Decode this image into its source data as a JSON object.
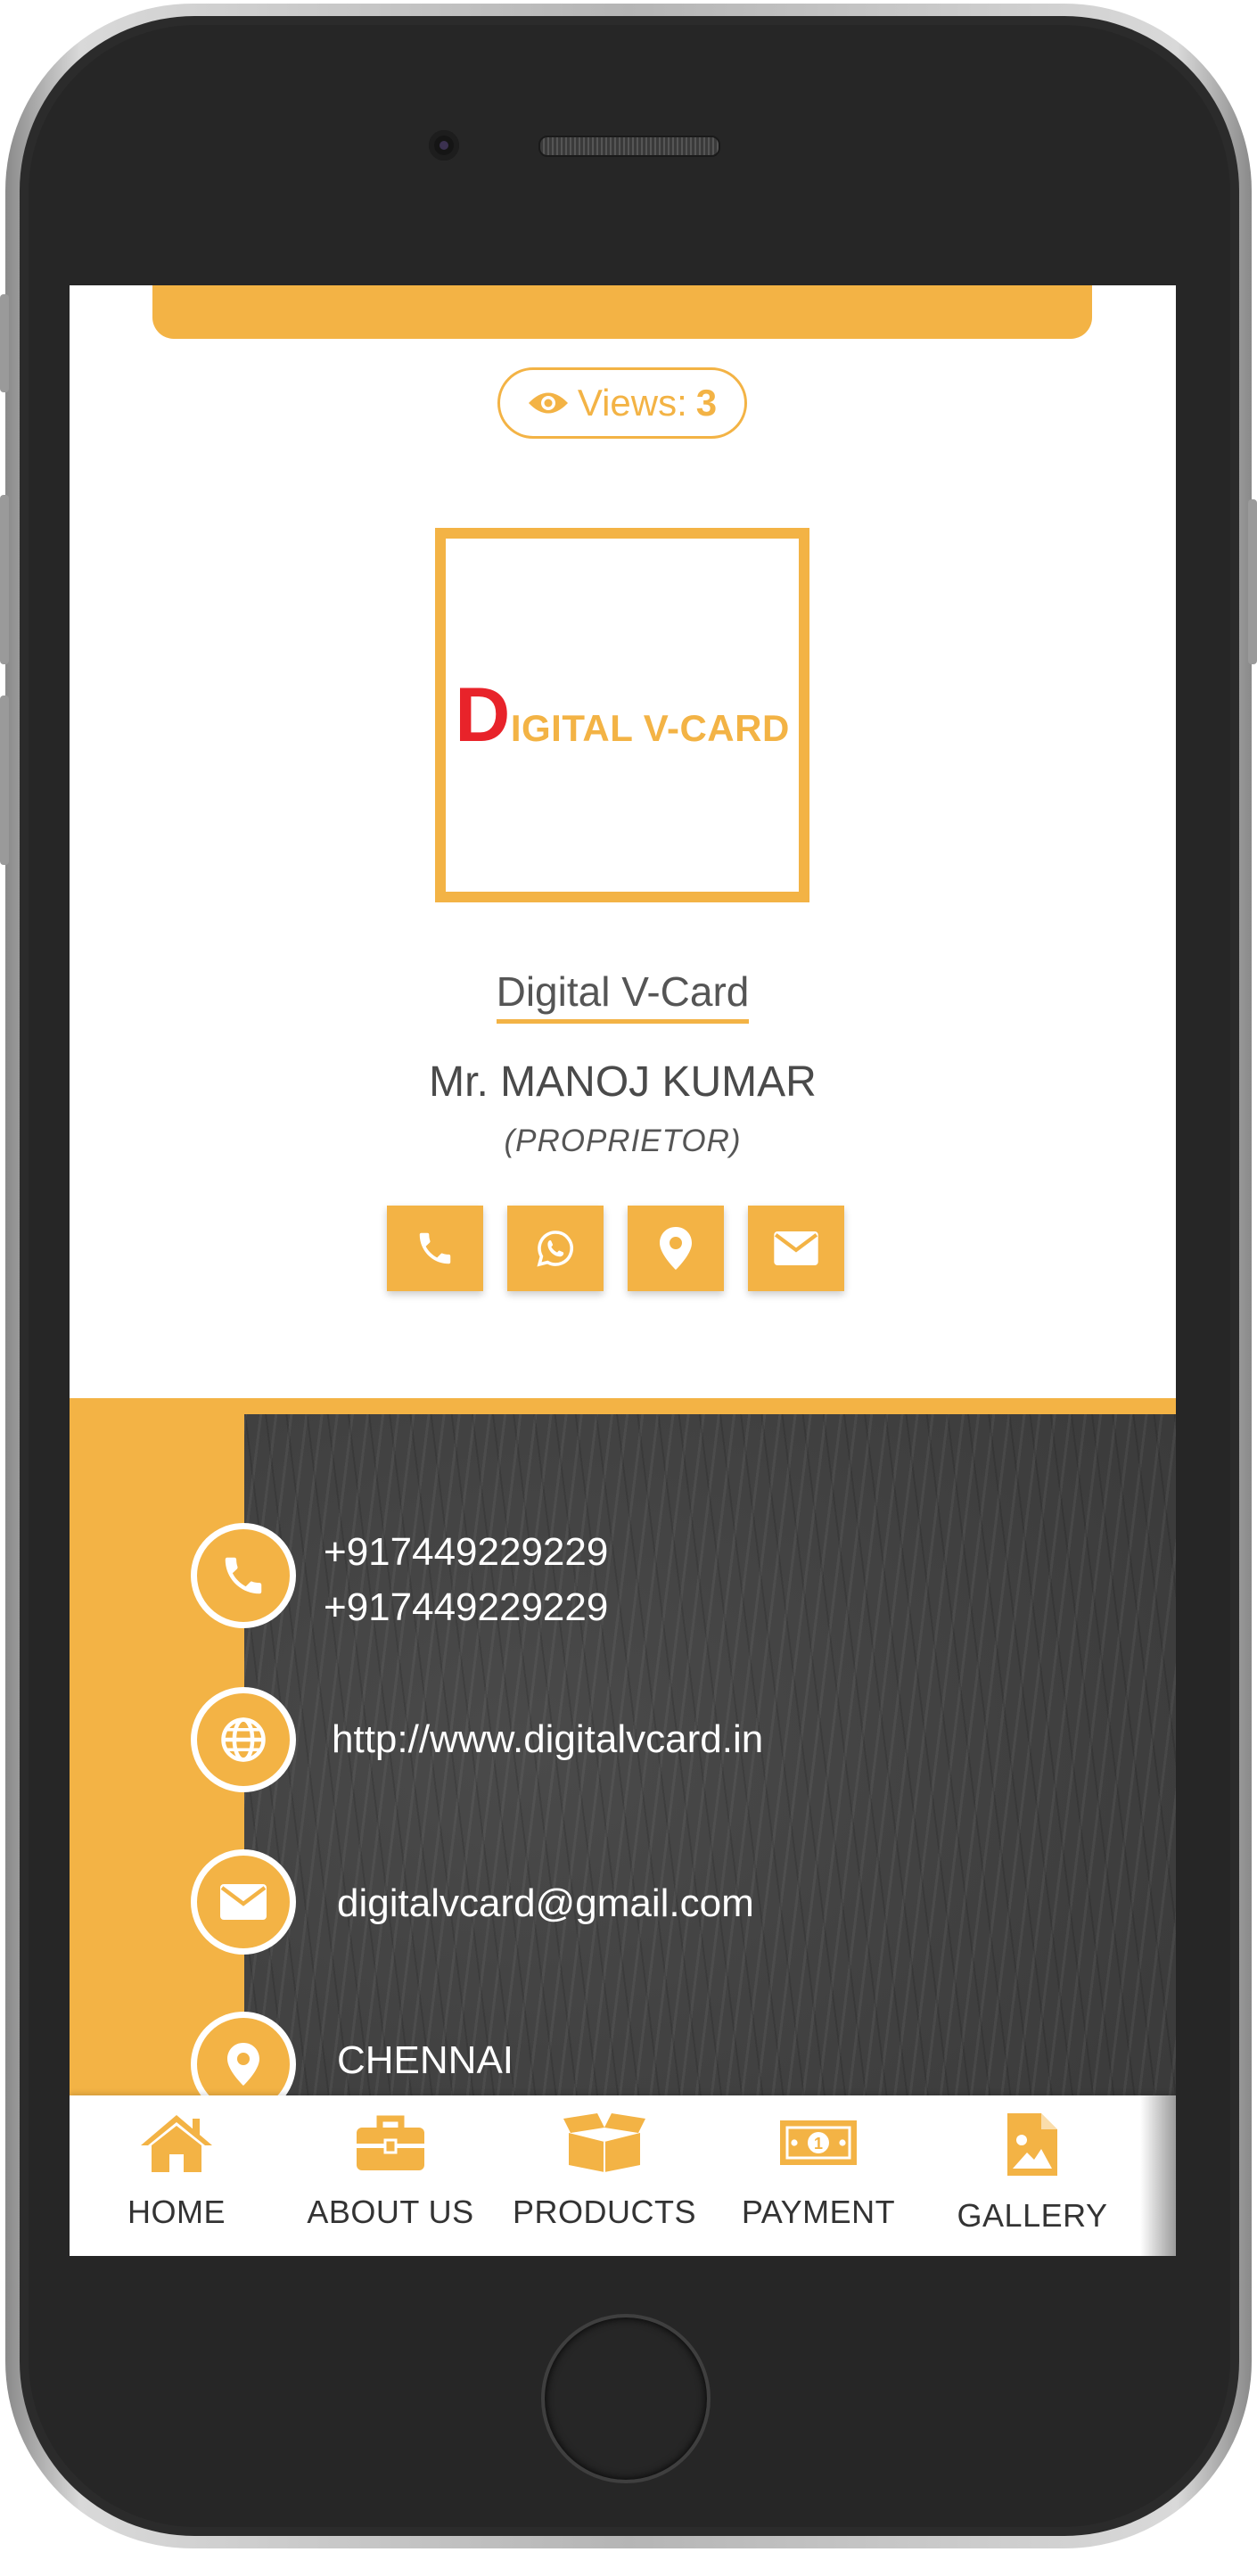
{
  "colors": {
    "accent": "#f3b345",
    "logo_red": "#e8232a",
    "dark_bg": "#3a3a3a"
  },
  "views": {
    "label": "Views:",
    "count": "3"
  },
  "logo": {
    "first_letter": "D",
    "rest": "IGITAL V-CARD"
  },
  "profile": {
    "company": "Digital V-Card",
    "name": "Mr. MANOJ KUMAR",
    "role": "(PROPRIETOR)"
  },
  "quick_actions": [
    {
      "icon": "phone-icon"
    },
    {
      "icon": "whatsapp-icon"
    },
    {
      "icon": "location-pin-icon"
    },
    {
      "icon": "envelope-icon"
    }
  ],
  "contact": {
    "phone_1": "+917449229229",
    "phone_2": "+917449229229",
    "website": "http://www.digitalvcard.in",
    "email": "digitalvcard@gmail.com",
    "address": "CHENNAI"
  },
  "bottom_nav": [
    {
      "label": "HOME",
      "icon": "home-icon"
    },
    {
      "label": "ABOUT US",
      "icon": "briefcase-icon"
    },
    {
      "label": "PRODUCTS",
      "icon": "box-icon"
    },
    {
      "label": "PAYMENT",
      "icon": "money-icon"
    },
    {
      "label": "GALLERY",
      "icon": "image-file-icon"
    }
  ]
}
